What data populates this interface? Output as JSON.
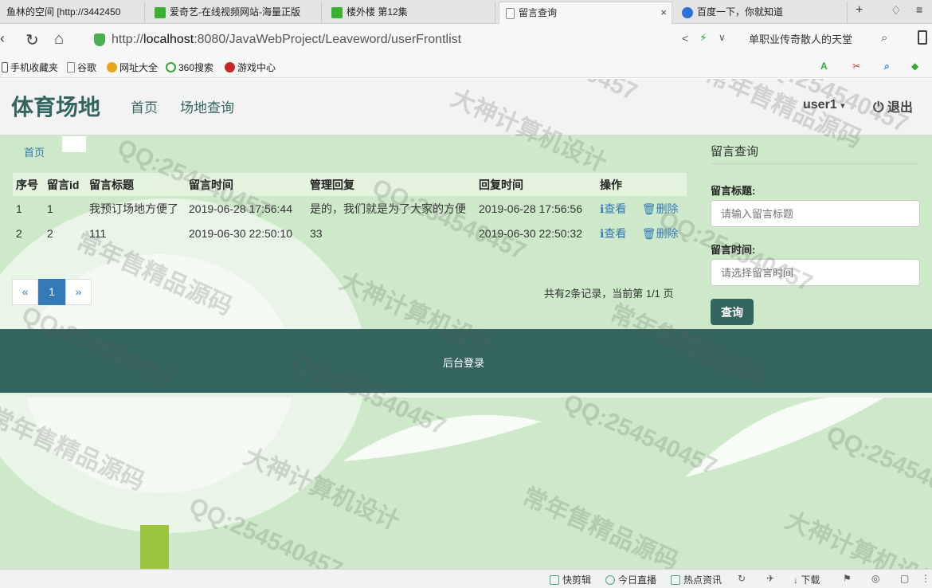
{
  "browser": {
    "tabs": [
      {
        "title": "鱼林的空间 [http://3442450",
        "active": false
      },
      {
        "title": "爱奇艺-在线视频网站-海量正版",
        "active": false
      },
      {
        "title": "楼外楼 第12集",
        "active": false
      },
      {
        "title": "留言查询",
        "active": true,
        "close": "×"
      },
      {
        "title": "百度一下，你就知道",
        "active": false
      }
    ],
    "new_tab": "+",
    "url": {
      "scheme": "http://",
      "host": "localhost",
      "rest": ":8080/JavaWebProject/Leaveword/userFrontlist"
    },
    "search_text": "单职业传奇散人的天堂",
    "bookmarks": [
      "手机收藏夹",
      "谷歌",
      "网址大全",
      "360搜索",
      "游戏中心"
    ],
    "status_items": [
      "快剪辑",
      "今日直播",
      "热点资讯",
      "下载"
    ]
  },
  "site": {
    "brand": "体育场地",
    "nav": [
      "首页",
      "场地查询"
    ],
    "user": "user1",
    "user_caret": "▾",
    "logout": "退出"
  },
  "breadcrumb": "首页",
  "table": {
    "headers": [
      "序号",
      "留言id",
      "留言标题",
      "留言时间",
      "管理回复",
      "回复时间",
      "操作"
    ],
    "rows": [
      {
        "no": "1",
        "id": "1",
        "title": "我预订场地方便了",
        "time": "2019-06-28 17:56:44",
        "reply": "是的，我们就是为了大家的方便",
        "reply_time": "2019-06-28 17:56:56"
      },
      {
        "no": "2",
        "id": "2",
        "title": "111",
        "time": "2019-06-30 22:50:10",
        "reply": "33",
        "reply_time": "2019-06-30 22:50:32"
      }
    ],
    "view_label": "查看",
    "delete_label": "删除"
  },
  "pager": {
    "prev": "«",
    "current": "1",
    "next": "»",
    "summary": "共有2条记录，当前第 1/1 页"
  },
  "sidebar": {
    "title": "留言查询",
    "title_label": "留言标题:",
    "title_placeholder": "请输入留言标题",
    "time_label": "留言时间:",
    "time_placeholder": "请选择留言时间",
    "query_button": "查询"
  },
  "footer": {
    "admin_login": "后台登录"
  },
  "watermark": [
    "QQ:254540457",
    "大神计算机设计",
    "常年售精品源码"
  ],
  "colors": {
    "theme": "#356560",
    "link": "#337ab7",
    "page_bg": "#cde9c9"
  }
}
